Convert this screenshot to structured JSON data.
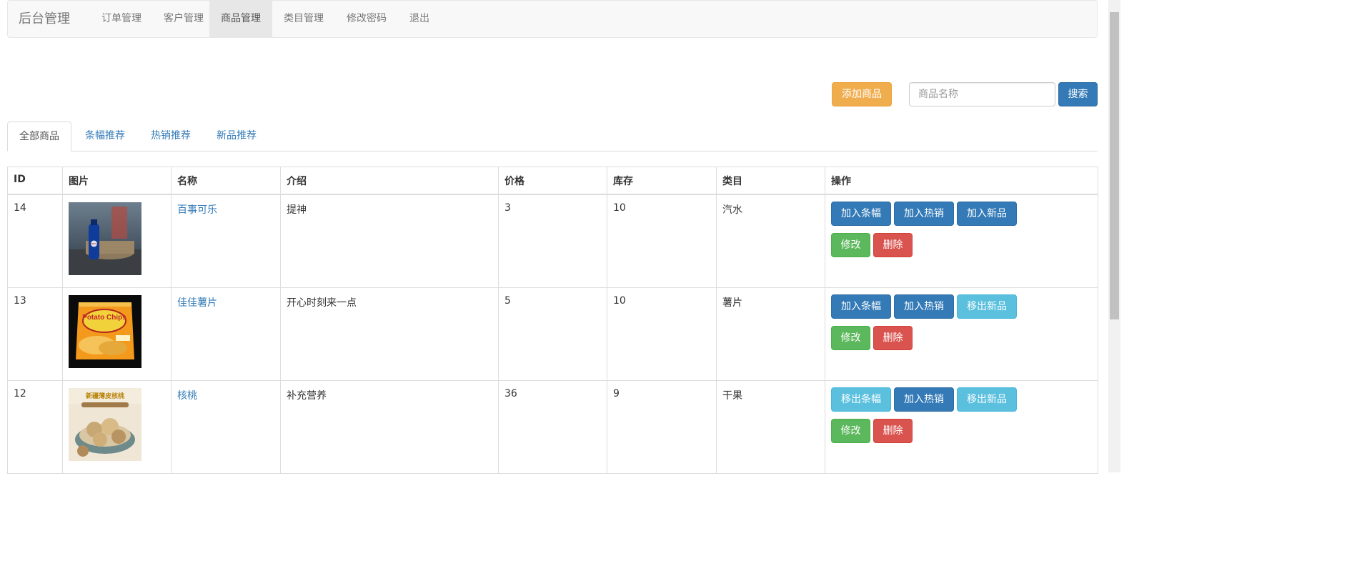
{
  "navbar": {
    "brand": "后台管理",
    "items": [
      {
        "label": "订单管理"
      },
      {
        "label": "客户管理"
      },
      {
        "label": "商品管理"
      },
      {
        "label": "类目管理"
      },
      {
        "label": "修改密码"
      },
      {
        "label": "退出"
      }
    ],
    "active_index": 2
  },
  "toolbar": {
    "add_label": "添加商品",
    "search_placeholder": "商品名称",
    "search_value": "",
    "search_label": "搜索"
  },
  "tabs": [
    {
      "label": "全部商品"
    },
    {
      "label": "条幅推荐"
    },
    {
      "label": "热销推荐"
    },
    {
      "label": "新品推荐"
    }
  ],
  "table": {
    "headers": [
      "ID",
      "图片",
      "名称",
      "介绍",
      "价格",
      "库存",
      "类目",
      "操作"
    ],
    "rows": [
      {
        "id": "14",
        "name": "百事可乐",
        "intro": "提神",
        "price": "3",
        "stock": "10",
        "category": "汽水",
        "banner_label": "加入条幅",
        "hot_label": "加入热销",
        "new_label": "加入新品",
        "edit_label": "修改",
        "delete_label": "删除"
      },
      {
        "id": "13",
        "name": "佳佳薯片",
        "intro": "开心时刻来一点",
        "price": "5",
        "stock": "10",
        "category": "薯片",
        "banner_label": "加入条幅",
        "hot_label": "加入热销",
        "new_label": "移出新品",
        "edit_label": "修改",
        "delete_label": "删除"
      },
      {
        "id": "12",
        "name": "核桃",
        "intro": "补充营养",
        "price": "36",
        "stock": "9",
        "category": "干果",
        "banner_label": "移出条幅",
        "hot_label": "加入热销",
        "new_label": "移出新品",
        "edit_label": "修改",
        "delete_label": "删除"
      }
    ]
  },
  "images": {
    "row0_logo_text": "PEPSI",
    "row1_logo_text": "Potato Chips",
    "row2_logo_text": "新疆薄皮核桃"
  },
  "colors": {
    "primary": "#337ab7",
    "info": "#5bc0de",
    "success": "#5cb85c",
    "danger": "#d9534f",
    "warning": "#f0ad4e"
  }
}
